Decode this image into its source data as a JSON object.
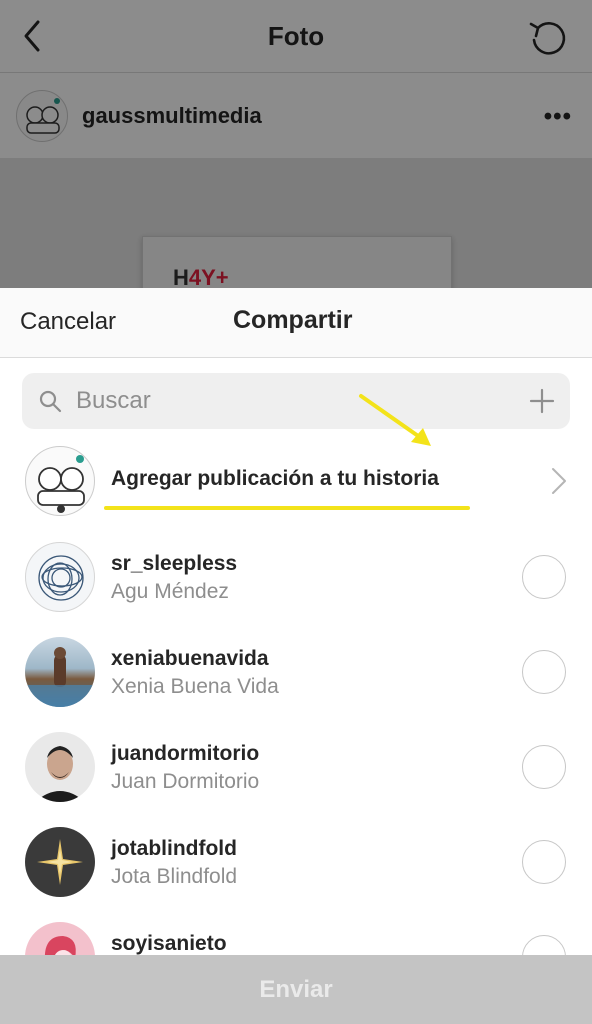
{
  "background": {
    "title": "Foto",
    "post_user": "gaussmultimedia",
    "more": "•••",
    "photo_text_a": "H",
    "photo_text_b": "4Y+"
  },
  "sheet": {
    "cancel_label": "Cancelar",
    "title": "Compartir",
    "search_placeholder": "Buscar",
    "story_label": "Agregar publicación a tu historia",
    "send_label": "Enviar",
    "contacts": [
      {
        "username": "sr_sleepless",
        "name": "Agu Méndez"
      },
      {
        "username": "xeniabuenavida",
        "name": "Xenia Buena Vida"
      },
      {
        "username": "juandormitorio",
        "name": "Juan Dormitorio"
      },
      {
        "username": "jotablindfold",
        "name": "Jota Blindfold"
      },
      {
        "username": "soyisanieto",
        "name": ""
      }
    ]
  },
  "colors": {
    "accent_highlight": "#f3e31a",
    "text_primary": "#262626",
    "text_secondary": "#8e8e8e",
    "send_bar": "#c4c4c4"
  },
  "icons": [
    "back-arrow-icon",
    "refresh-icon",
    "more-icon",
    "search-icon",
    "plus-icon",
    "chevron-right-icon",
    "yellow-arrow-annotation"
  ]
}
